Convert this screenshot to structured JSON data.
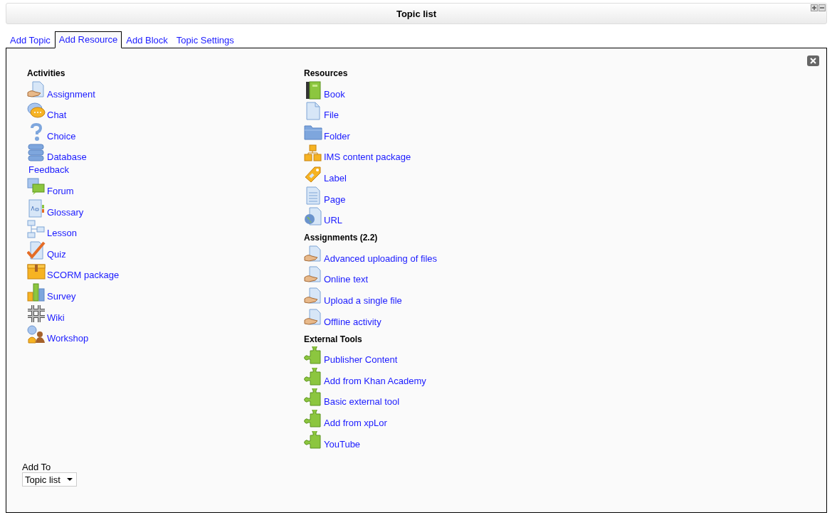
{
  "header": {
    "title": "Topic list"
  },
  "tabs": [
    {
      "label": "Add Topic",
      "selected": false
    },
    {
      "label": "Add Resource",
      "selected": true
    },
    {
      "label": "Add Block",
      "selected": false
    },
    {
      "label": "Topic Settings",
      "selected": false
    }
  ],
  "columns": [
    {
      "sections": [
        {
          "heading": "Activities",
          "items": [
            {
              "label": "Assignment",
              "kind": "assignment"
            },
            {
              "label": "Chat",
              "kind": "chat"
            },
            {
              "label": "Choice",
              "kind": "choice"
            },
            {
              "label": "Database",
              "kind": "database"
            },
            {
              "label": "Feedback",
              "kind": "none"
            },
            {
              "label": "Forum",
              "kind": "forum"
            },
            {
              "label": "Glossary",
              "kind": "glossary"
            },
            {
              "label": "Lesson",
              "kind": "lesson"
            },
            {
              "label": "Quiz",
              "kind": "quiz"
            },
            {
              "label": "SCORM package",
              "kind": "scorm"
            },
            {
              "label": "Survey",
              "kind": "survey"
            },
            {
              "label": "Wiki",
              "kind": "wiki"
            },
            {
              "label": "Workshop",
              "kind": "workshop"
            }
          ]
        }
      ]
    },
    {
      "sections": [
        {
          "heading": "Resources",
          "items": [
            {
              "label": "Book",
              "kind": "book"
            },
            {
              "label": "File",
              "kind": "file"
            },
            {
              "label": "Folder",
              "kind": "folder"
            },
            {
              "label": "IMS content package",
              "kind": "ims"
            },
            {
              "label": "Label",
              "kind": "label"
            },
            {
              "label": "Page",
              "kind": "page"
            },
            {
              "label": "URL",
              "kind": "url"
            }
          ]
        },
        {
          "heading": "Assignments (2.2)",
          "items": [
            {
              "label": "Advanced uploading of files",
              "kind": "assignment"
            },
            {
              "label": "Online text",
              "kind": "assignment"
            },
            {
              "label": "Upload a single file",
              "kind": "assignment"
            },
            {
              "label": "Offline activity",
              "kind": "assignment"
            }
          ]
        },
        {
          "heading": "External Tools",
          "items": [
            {
              "label": "Publisher Content",
              "kind": "puzzle"
            },
            {
              "label": "Add from Khan Academy",
              "kind": "puzzle"
            },
            {
              "label": "Basic external tool",
              "kind": "puzzle"
            },
            {
              "label": "Add from xpLor",
              "kind": "puzzle"
            },
            {
              "label": "YouTube",
              "kind": "puzzle"
            }
          ]
        }
      ]
    }
  ],
  "add_to": {
    "label": "Add To",
    "value": "Topic list"
  }
}
